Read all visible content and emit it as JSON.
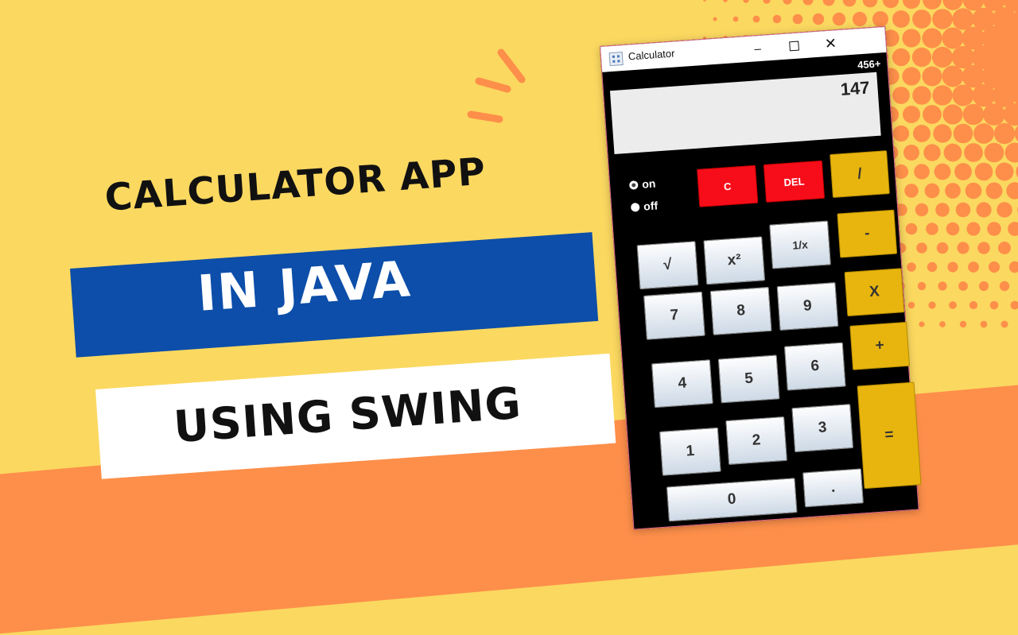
{
  "headline": "CALCULATOR APP",
  "band_blue": "IN JAVA",
  "band_white": "USING SWING",
  "window": {
    "title": "Calculator",
    "controls": {
      "minimize": "–",
      "close": "✕"
    }
  },
  "calculator": {
    "history": "456+",
    "display": "147",
    "radio_on": "on",
    "radio_off": "off",
    "power_state": "on",
    "buttons": {
      "clear": "C",
      "delete": "DEL",
      "divide": "/",
      "minus": "-",
      "sqrt": "√",
      "square": "x²",
      "reciprocal": "1/x",
      "multiply": "X",
      "n7": "7",
      "n8": "8",
      "n9": "9",
      "plus": "+",
      "n4": "4",
      "n5": "5",
      "n6": "6",
      "n1": "1",
      "n2": "2",
      "n3": "3",
      "equals": "=",
      "n0": "0",
      "dot": "."
    }
  },
  "colors": {
    "background": "#fbd860",
    "bottom_band": "#fd8f4a",
    "blue_band": "#0c4ea9",
    "operator": "#e8b50f",
    "danger": "#f70d1a"
  }
}
